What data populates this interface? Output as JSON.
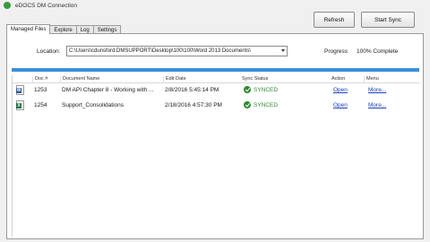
{
  "window": {
    "title": "eDOCS DM Connection"
  },
  "toolbar": {
    "refresh_label": "Refresh",
    "start_sync_label": "Start Sync"
  },
  "tabs": [
    {
      "label": "Managed Files",
      "active": true
    },
    {
      "label": "Explore",
      "active": false
    },
    {
      "label": "Log",
      "active": false
    },
    {
      "label": "Settings",
      "active": false
    }
  ],
  "location": {
    "label": "Location:",
    "value": "C:\\Users\\cdunsford.DMSUPPORT\\Desktop\\100\\100\\Word 2013 Documents\\"
  },
  "progress": {
    "label": "Progress",
    "value_text": "100% Complete",
    "value": 1.0
  },
  "table": {
    "headers": [
      "Doc #",
      "Document Name",
      "Edit Date",
      "Sync Status",
      "Action",
      "Menu"
    ],
    "rows": [
      {
        "icon": "word-doc-icon",
        "doc_no": "1253",
        "name": "DM API Chapter 8 - Working with ...",
        "edit_date": "2/8/2016 5:45:14 PM",
        "status": "SYNCED",
        "action": "Open",
        "menu": "More..."
      },
      {
        "icon": "excel-doc-icon",
        "doc_no": "1254",
        "name": "Support_Consolidations",
        "edit_date": "2/18/2016 4:57:30 PM",
        "status": "SYNCED",
        "action": "Open",
        "menu": "More..."
      }
    ]
  },
  "colors": {
    "accent": "#3b8fdc",
    "synced": "#2e8b2e",
    "link": "#1a3fb8"
  }
}
